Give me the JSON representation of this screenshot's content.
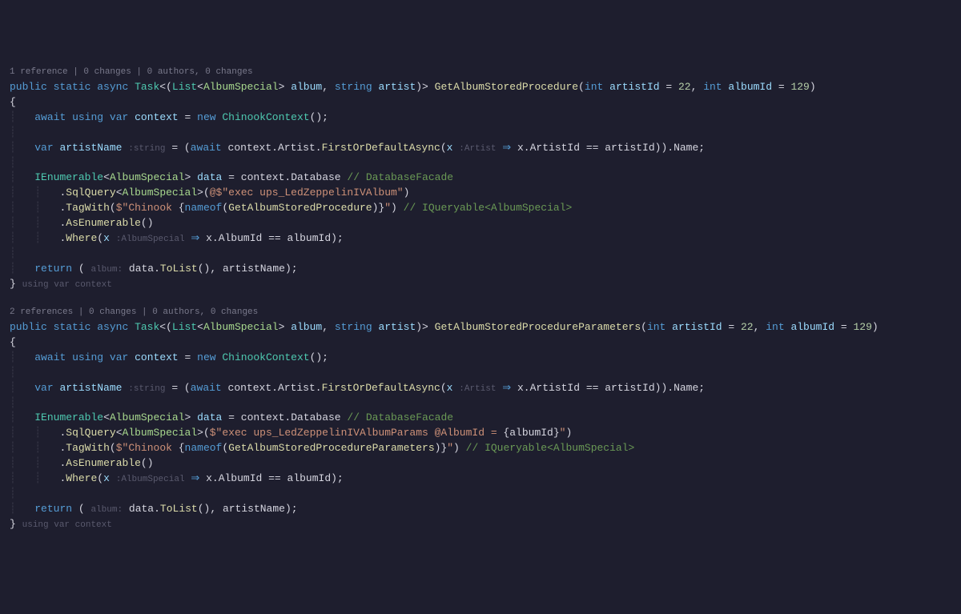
{
  "method1": {
    "codelens": "1 reference | 0 changes | 0 authors, 0 changes",
    "sig": {
      "public": "public",
      "static": "static",
      "async": "async",
      "task": "Task",
      "list": "List",
      "type": "AlbumSpecial",
      "albumLabel": "album",
      "string": "string",
      "artistLabel": "artist",
      "name": "GetAlbumStoredProcedure",
      "int1": "int",
      "p1": "artistId",
      "d1": "22",
      "int2": "int",
      "p2": "albumId",
      "d2": "129"
    },
    "l3": {
      "await": "await",
      "using": "using",
      "var": "var",
      "ctx": "context",
      "new": "new",
      "ctor": "ChinookContext"
    },
    "l4": {
      "var": "var",
      "name": "artistName",
      "hint": ":string",
      "await": "await",
      "ctx": "context",
      "artist": "Artist",
      "first": "FirstOrDefaultAsync",
      "x": "x",
      "xhint": ":Artist",
      "arrow": " ⇒ ",
      "artistId": "ArtistId",
      "eq": " == ",
      "param": "artistId",
      "nameMember": "Name"
    },
    "l5": {
      "ienum": "IEnumerable",
      "type": "AlbumSpecial",
      "data": "data",
      "ctx": "context",
      "db": "Database",
      "comment": "// DatabaseFacade"
    },
    "l6": {
      "sql": "SqlQuery",
      "type": "AlbumSpecial",
      "prefix": "@$\"",
      "str": "exec ups_LedZeppelinIVAlbum",
      "suffix": "\""
    },
    "l7": {
      "tag": "TagWith",
      "prefix": "$\"",
      "s1": "Chinook ",
      "nameof": "nameof",
      "m": "GetAlbumStoredProcedure",
      "suffix": "\"",
      "comment": "// IQueryable<AlbumSpecial>"
    },
    "l8": {
      "asenum": "AsEnumerable"
    },
    "l9": {
      "where": "Where",
      "x": "x",
      "xhint": ":AlbumSpecial",
      "arrow": " ⇒ ",
      "albumId": "AlbumId",
      "eq": " == ",
      "param": "albumId"
    },
    "l10": {
      "return": "return",
      "albumLabel": "album:",
      "data": "data",
      "tolist": "ToList",
      "artistName": "artistName"
    },
    "l11": {
      "hint": "using var context"
    }
  },
  "method2": {
    "codelens": "2 references | 0 changes | 0 authors, 0 changes",
    "sig": {
      "public": "public",
      "static": "static",
      "async": "async",
      "task": "Task",
      "list": "List",
      "type": "AlbumSpecial",
      "albumLabel": "album",
      "string": "string",
      "artistLabel": "artist",
      "name": "GetAlbumStoredProcedureParameters",
      "int1": "int",
      "p1": "artistId",
      "d1": "22",
      "int2": "int",
      "p2": "albumId",
      "d2": "129"
    },
    "l3": {
      "await": "await",
      "using": "using",
      "var": "var",
      "ctx": "context",
      "new": "new",
      "ctor": "ChinookContext"
    },
    "l4": {
      "var": "var",
      "name": "artistName",
      "hint": ":string",
      "await": "await",
      "ctx": "context",
      "artist": "Artist",
      "first": "FirstOrDefaultAsync",
      "x": "x",
      "xhint": ":Artist",
      "arrow": " ⇒ ",
      "artistId": "ArtistId",
      "eq": " == ",
      "param": "artistId",
      "nameMember": "Name"
    },
    "l5": {
      "ienum": "IEnumerable",
      "type": "AlbumSpecial",
      "data": "data",
      "ctx": "context",
      "db": "Database",
      "comment": "// DatabaseFacade"
    },
    "l6": {
      "sql": "SqlQuery",
      "type": "AlbumSpecial",
      "prefix": "$\"",
      "str1": "exec ups_LedZeppelinIVAlbumParams @AlbumId = ",
      "interp": "albumId",
      "suffix": "\""
    },
    "l7": {
      "tag": "TagWith",
      "prefix": "$\"",
      "s1": "Chinook ",
      "nameof": "nameof",
      "m": "GetAlbumStoredProcedureParameters",
      "suffix": "\"",
      "comment": "// IQueryable<AlbumSpecial>"
    },
    "l8": {
      "asenum": "AsEnumerable"
    },
    "l9": {
      "where": "Where",
      "x": "x",
      "xhint": ":AlbumSpecial",
      "arrow": " ⇒ ",
      "albumId": "AlbumId",
      "eq": " == ",
      "param": "albumId"
    },
    "l10": {
      "return": "return",
      "albumLabel": "album:",
      "data": "data",
      "tolist": "ToList",
      "artistName": "artistName"
    },
    "l11": {
      "hint": "using var context"
    }
  }
}
